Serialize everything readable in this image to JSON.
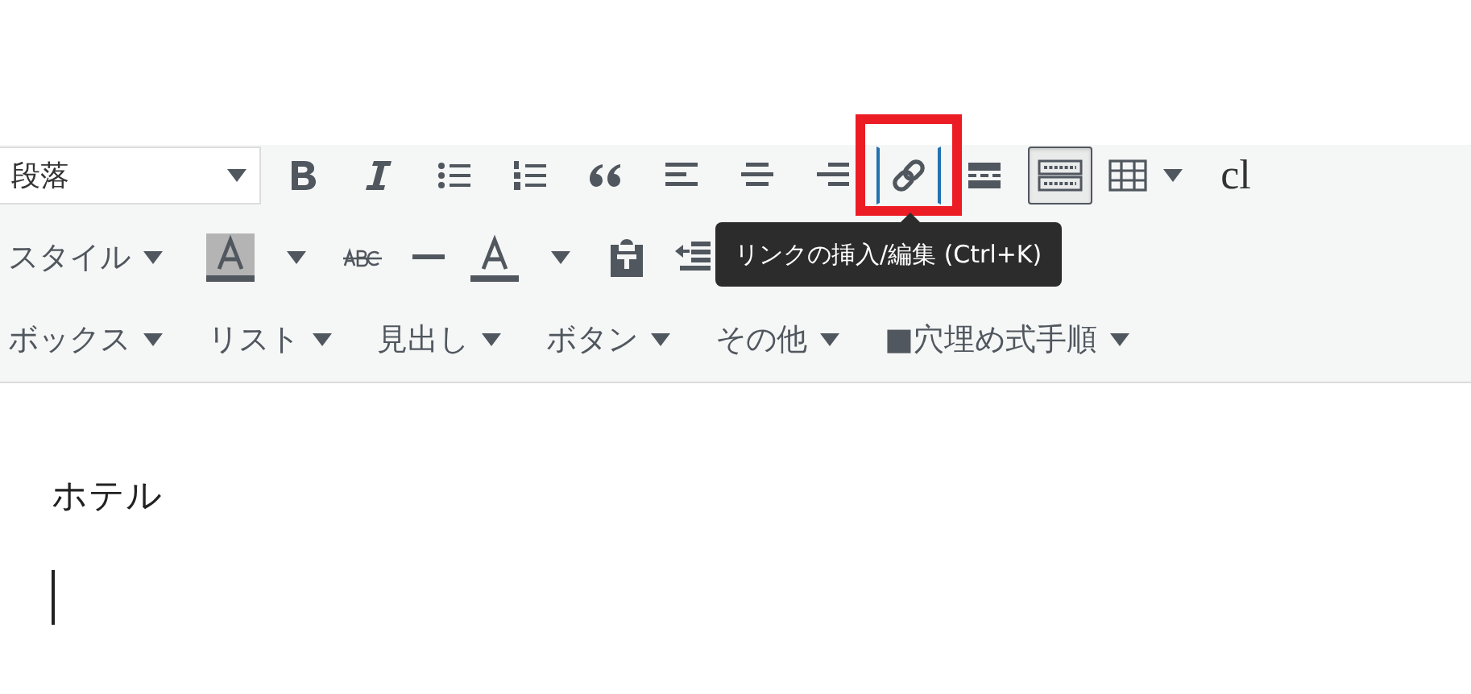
{
  "format_select": {
    "value": "段落"
  },
  "toolbar_row_1": [
    {
      "kind": "bold",
      "pressed": false,
      "focused": false
    },
    {
      "kind": "italic",
      "pressed": false,
      "focused": false
    },
    {
      "kind": "bullet-list",
      "pressed": false,
      "focused": false
    },
    {
      "kind": "numbered-list",
      "pressed": false,
      "focused": false
    },
    {
      "kind": "quote",
      "pressed": false,
      "focused": false
    },
    {
      "kind": "align-left",
      "pressed": false,
      "focused": false
    },
    {
      "kind": "align-center",
      "pressed": false,
      "focused": false
    },
    {
      "kind": "align-right",
      "pressed": false,
      "focused": false
    },
    {
      "kind": "link",
      "pressed": false,
      "focused": true
    },
    {
      "kind": "more",
      "pressed": false,
      "focused": false
    },
    {
      "kind": "keyboard",
      "pressed": true,
      "focused": false
    },
    {
      "kind": "table",
      "pressed": false,
      "focused": false
    },
    {
      "kind": "text",
      "label": "cl"
    }
  ],
  "toolbar_row_2": [
    {
      "kind": "menu",
      "label": "スタイル"
    },
    {
      "kind": "highlight-color"
    },
    {
      "kind": "caret"
    },
    {
      "kind": "strikethrough"
    },
    {
      "kind": "horizontal-line"
    },
    {
      "kind": "text-color"
    },
    {
      "kind": "caret"
    },
    {
      "kind": "paste"
    },
    {
      "kind": "outdent"
    }
  ],
  "toolbar_row_3": [
    {
      "label": "ボックス"
    },
    {
      "label": "リスト"
    },
    {
      "label": "見出し"
    },
    {
      "label": "ボタン"
    },
    {
      "label": "その他"
    },
    {
      "label": "■穴埋め式手順"
    }
  ],
  "tooltip": {
    "text": "リンクの挿入/編集 (Ctrl+K)"
  },
  "editor": {
    "paragraphs": [
      "ホテル"
    ],
    "cursor": true
  }
}
